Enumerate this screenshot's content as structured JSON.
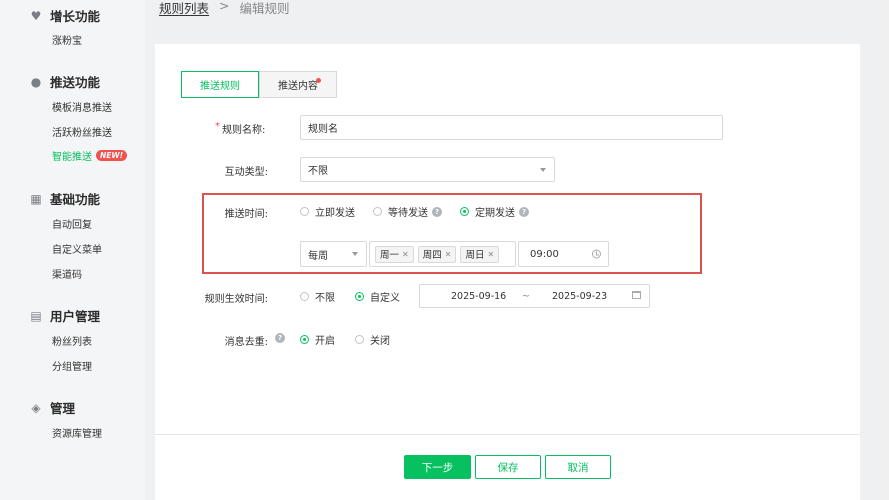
{
  "sidebar": {
    "groups": [
      {
        "title": "增长功能",
        "icon": "heart-icon",
        "items": [
          {
            "label": "涨粉宝"
          }
        ]
      },
      {
        "title": "推送功能",
        "icon": "user-icon",
        "items": [
          {
            "label": "模板消息推送"
          },
          {
            "label": "活跃粉丝推送"
          },
          {
            "label": "智能推送",
            "badge": "NEW!"
          }
        ]
      },
      {
        "title": "基础功能",
        "icon": "grid-icon",
        "items": [
          {
            "label": "自动回复"
          },
          {
            "label": "自定义菜单"
          },
          {
            "label": "渠道码"
          }
        ]
      },
      {
        "title": "用户管理",
        "icon": "document-icon",
        "items": [
          {
            "label": "粉丝列表"
          },
          {
            "label": "分组管理"
          }
        ]
      },
      {
        "title": "管理",
        "icon": "layers-icon",
        "items": [
          {
            "label": "资源库管理"
          }
        ]
      }
    ]
  },
  "breadcrumb": {
    "parent": "规则列表",
    "separator": ">",
    "current": "编辑规则"
  },
  "tabs": [
    {
      "label": "推送规则"
    },
    {
      "label": "推送内容"
    }
  ],
  "form": {
    "name_label": "规则名称:",
    "name_value": "规则名",
    "interaction_label": "互动类型:",
    "interaction_value": "不限",
    "push_time_label": "推送时间:",
    "push_time_options": [
      "立即发送",
      "等待发送",
      "定期发送"
    ],
    "frequency_value": "每周",
    "days": [
      "周一",
      "周四",
      "周日"
    ],
    "time_value": "09:00",
    "validity_label": "规则生效时间:",
    "validity_options": [
      "不限",
      "自定义"
    ],
    "date_start": "2025-09-16",
    "date_sep": "~",
    "date_end": "2025-09-23",
    "dedup_label": "消息去重:",
    "dedup_options": [
      "开启",
      "关闭"
    ]
  },
  "actions": {
    "next": "下一步",
    "save": "保存",
    "cancel": "取消"
  },
  "colors": {
    "accent": "#07c160",
    "highlight_box": "#d9534f",
    "badge": "#ef5350"
  }
}
